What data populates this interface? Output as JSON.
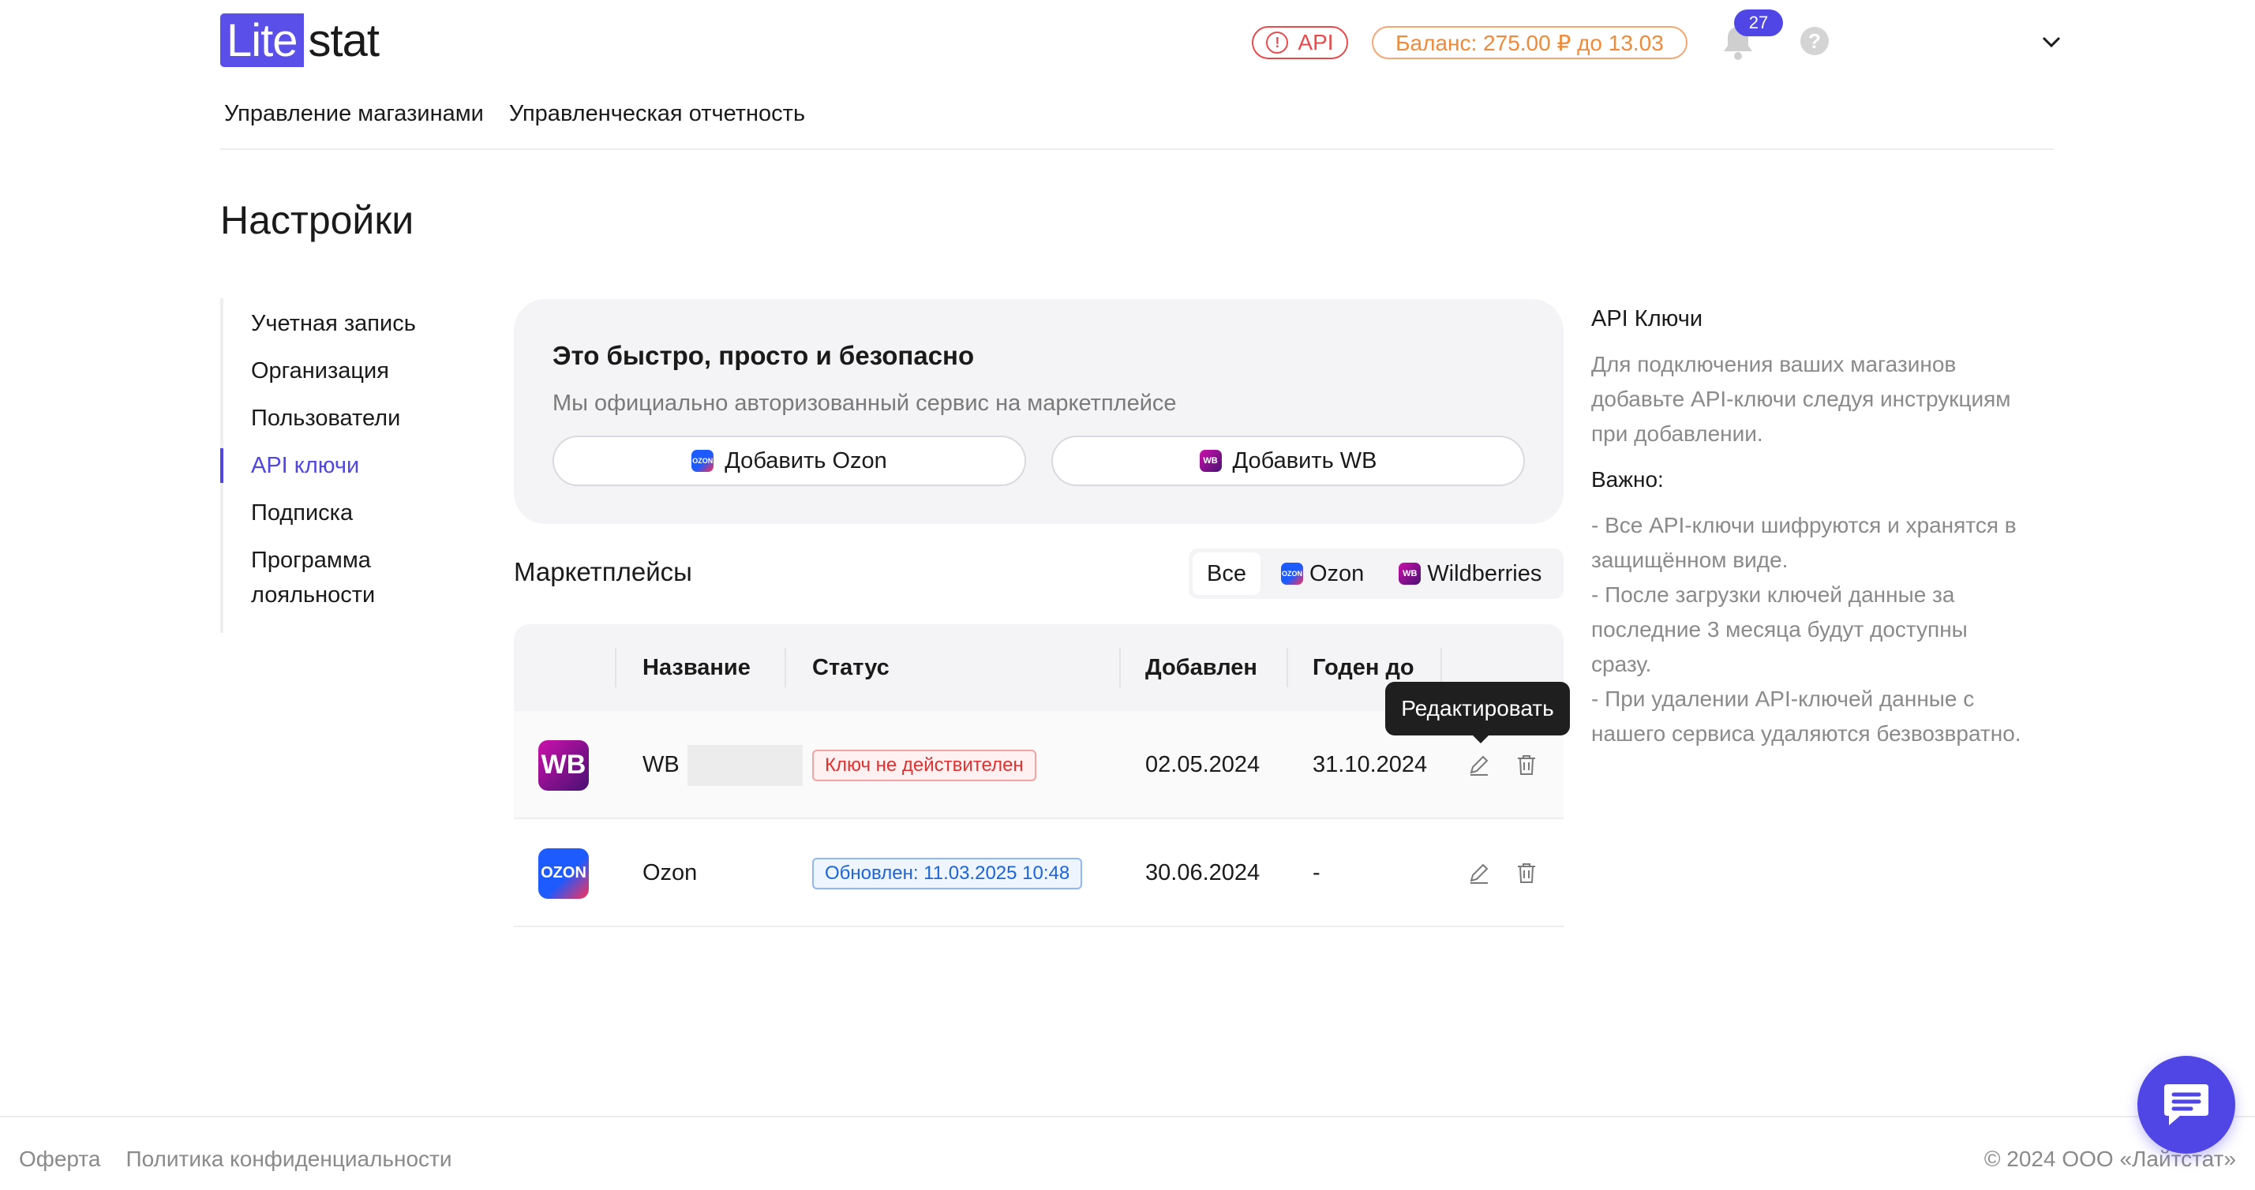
{
  "header": {
    "logo": {
      "part1": "Lite",
      "part2": "stat"
    },
    "api_badge": {
      "icon": "alert-circle-icon",
      "label": "API"
    },
    "balance": "Баланс: 275.00 ₽ до 13.03",
    "notifications_count": "27",
    "help_icon": "question-icon",
    "help_glyph": "?"
  },
  "topnav": [
    "Управление магазинами",
    "Управленческая отчетность"
  ],
  "page_title": "Настройки",
  "sidemenu": {
    "items": [
      {
        "label": "Учетная запись"
      },
      {
        "label": "Организация"
      },
      {
        "label": "Пользователи"
      },
      {
        "label": "API ключи",
        "active": true
      },
      {
        "label": "Подписка"
      },
      {
        "label": "Программа\nлояльности"
      }
    ]
  },
  "promo": {
    "title": "Это быстро, просто и безопасно",
    "subtitle": "Мы официально авторизованный сервис на маркетплейсе",
    "add_ozon": "Добавить Ozon",
    "add_wb": "Добавить WB"
  },
  "marketplaces": {
    "title": "Маркетплейсы",
    "filters": [
      "Все",
      "Ozon",
      "Wildberries"
    ],
    "active_filter": "Все",
    "columns": [
      "Название",
      "Статус",
      "Добавлен",
      "Годен до"
    ],
    "rows": [
      {
        "logo": "WB",
        "name": "WB",
        "status": "Ключ не действителен",
        "status_type": "error",
        "added": "02.05.2024",
        "valid_until": "31.10.2024"
      },
      {
        "logo": "OZON",
        "name": "Ozon",
        "status": "Обновлен: 11.03.2025 10:48",
        "status_type": "ok",
        "added": "30.06.2024",
        "valid_until": "-"
      }
    ],
    "tooltip": "Редактировать"
  },
  "info": {
    "title": "API Ключи",
    "intro": "Для подключения ваших магазинов добавьте API-ключи следуя инструкциям при добавлении.",
    "important": "Важно:",
    "bullets": [
      "- Все API-ключи шифруются и хранятся в защищённом виде.",
      "- После загрузки ключей данные за последние 3 месяца будут доступны сразу.",
      "- При удалении API-ключей данные с нашего сервиса удаляются безвозвратно."
    ]
  },
  "footer": {
    "offer": "Оферта",
    "privacy": "Политика конфиденциальности",
    "copyright": "© 2024 ООО «Лайтстат»"
  },
  "colors": {
    "accent": "#4f46e5",
    "error": "#e03131",
    "balance": "#ef8a3a",
    "ok": "#1c64d8"
  }
}
